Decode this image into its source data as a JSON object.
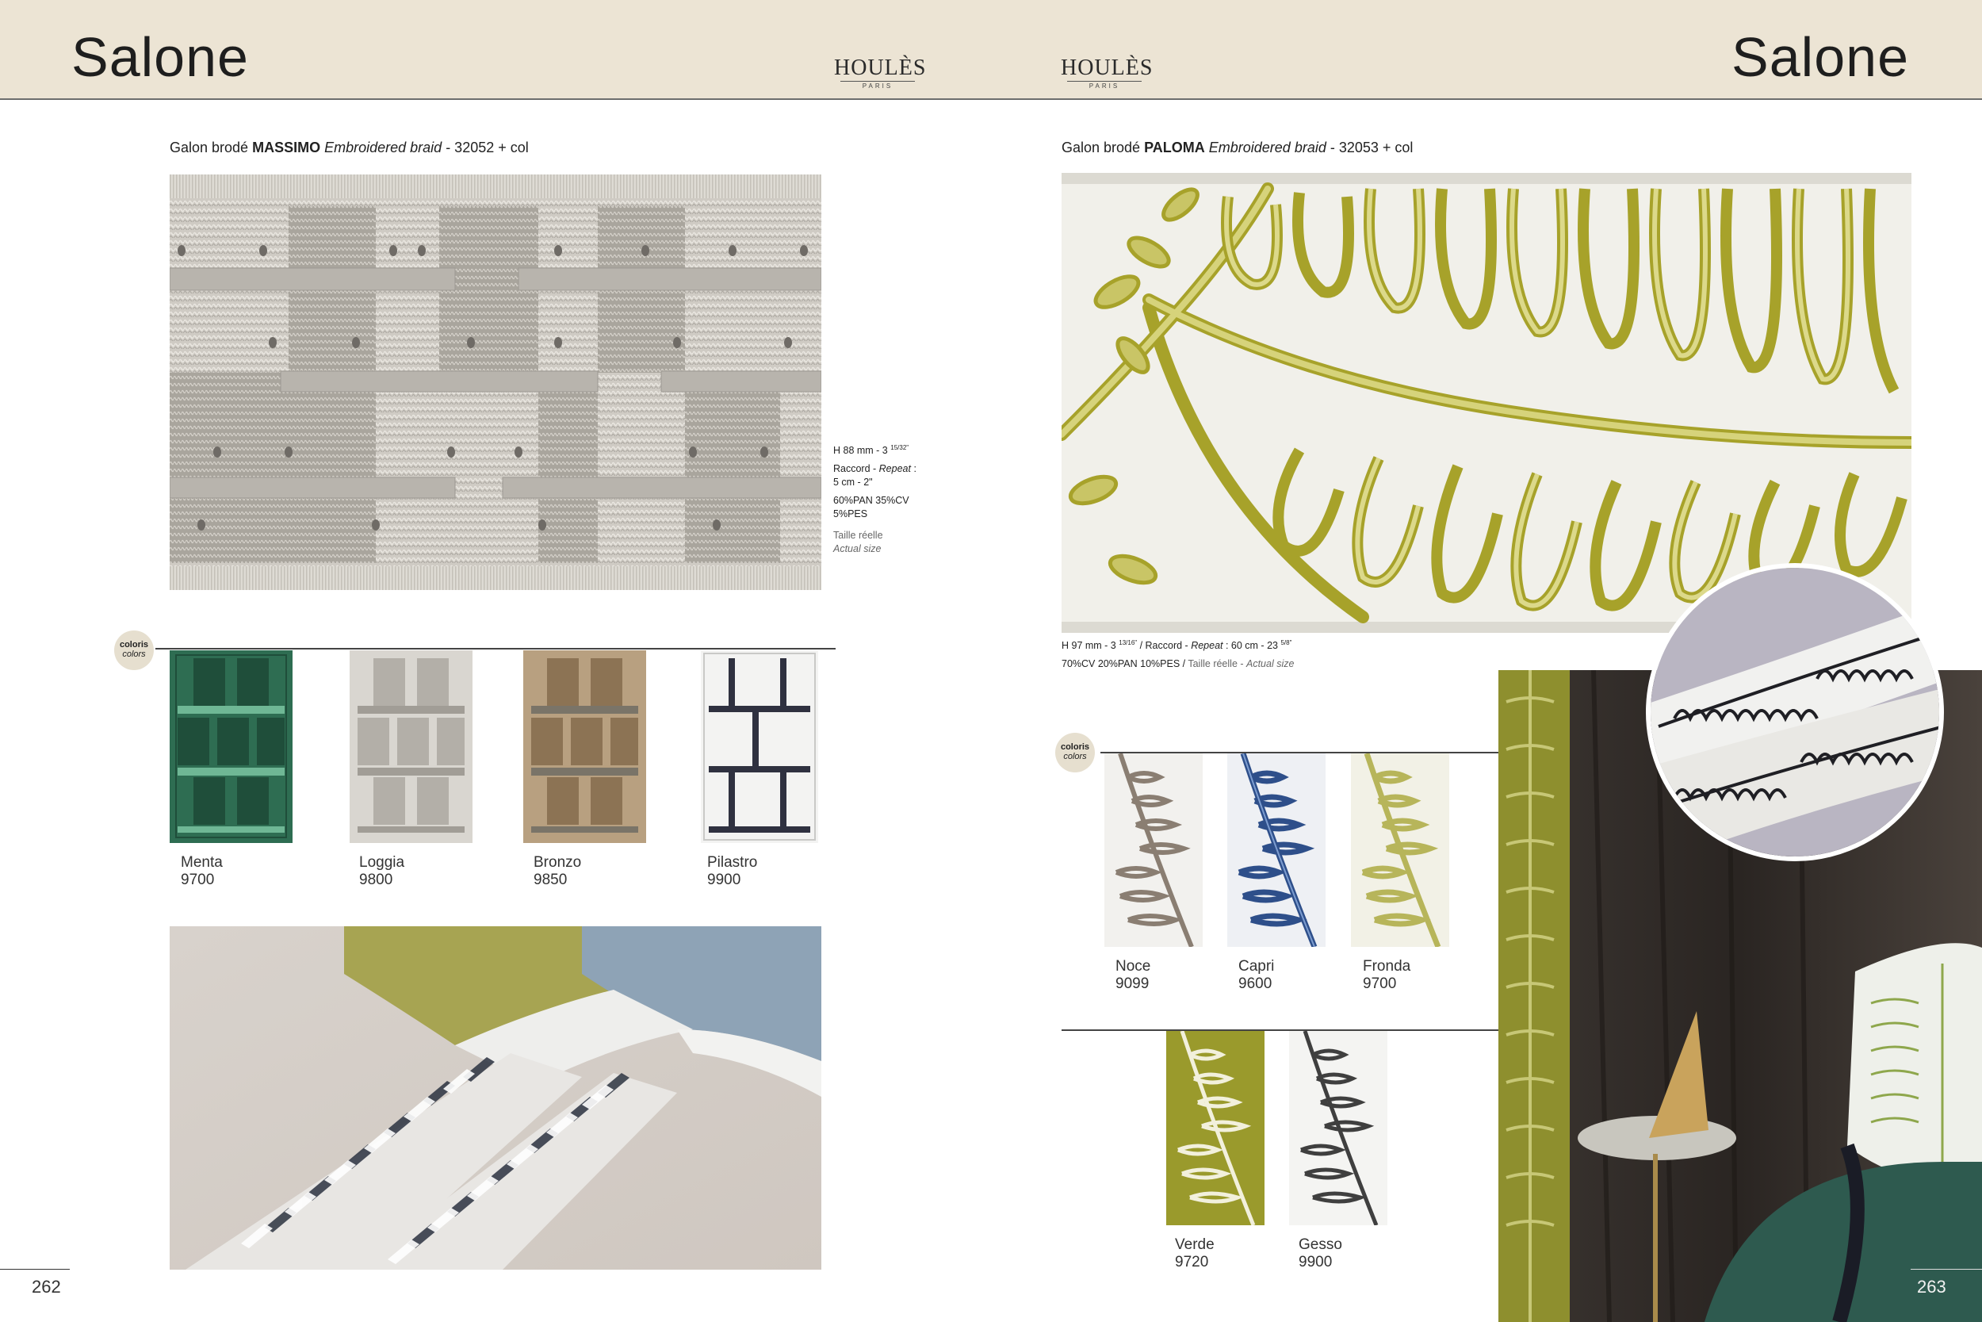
{
  "header": {
    "left_title": "Salone",
    "right_title": "Salone",
    "logo_brand": "HOULÈS",
    "logo_city": "PARIS"
  },
  "left": {
    "product": {
      "prefix": "Galon brodé ",
      "name": "MASSIMO",
      "english": "Embroidered braid",
      "ref": " - 32052 + col"
    },
    "specs": {
      "height_main": "H 88 mm - 3",
      "height_frac": "15/32\"",
      "repeat_prefix": "Raccord - ",
      "repeat_en": "Repeat",
      "repeat_suffix": " :",
      "repeat_value": "5 cm - 2\"",
      "composition_1": "60%PAN 35%CV",
      "composition_2": "5%PES",
      "size_fr": "Taille réelle",
      "size_en": "Actual size"
    },
    "coloris": {
      "fr": "coloris",
      "en": "colors"
    },
    "swatches": [
      {
        "name": "Menta",
        "code": "9700",
        "color": "#2e6d52"
      },
      {
        "name": "Loggia",
        "code": "9800",
        "color": "#c9c6bf"
      },
      {
        "name": "Bronzo",
        "code": "9850",
        "color": "#a98e6c"
      },
      {
        "name": "Pilastro",
        "code": "9900",
        "color": "#efefee"
      }
    ],
    "page_number": "262"
  },
  "right": {
    "product": {
      "prefix": "Galon brodé ",
      "name": "PALOMA",
      "english": "Embroidered braid",
      "ref": " - 32053 + col"
    },
    "specs": {
      "line1_main": "H 97 mm - 3",
      "line1_frac": "13/16\"",
      "line1_mid": " / Raccord - ",
      "line1_repeat_en": "Repeat",
      "line1_value": " : 60 cm - 23",
      "line1_frac2": "5/8\"",
      "line2_comp": "70%CV 20%PAN 10%PES / ",
      "line2_size_fr": "Taille réelle - ",
      "line2_size_en": "Actual size"
    },
    "coloris": {
      "fr": "coloris",
      "en": "colors"
    },
    "swatches_row1": [
      {
        "name": "Noce",
        "code": "9099",
        "color": "#8a7e72"
      },
      {
        "name": "Capri",
        "code": "9600",
        "color": "#2e4f8a"
      },
      {
        "name": "Fronda",
        "code": "9700",
        "color": "#b7b55a"
      }
    ],
    "swatches_row2": [
      {
        "name": "Verde",
        "code": "9720",
        "color": "#9a9a2c"
      },
      {
        "name": "Gesso",
        "code": "9900",
        "color": "#3f3f3f"
      }
    ],
    "page_number": "263"
  }
}
